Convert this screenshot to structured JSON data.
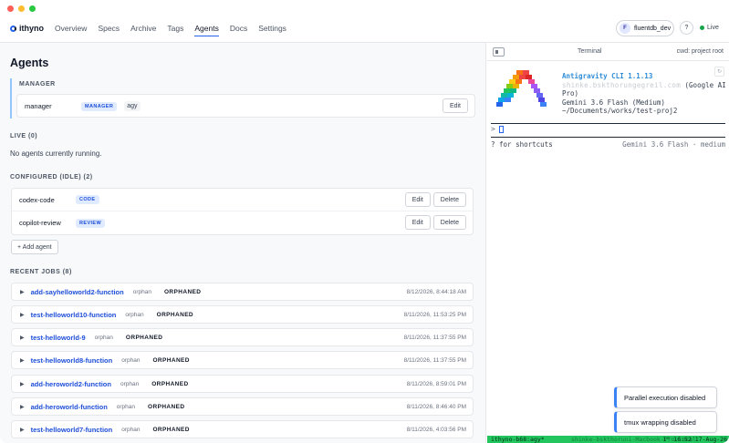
{
  "app": {
    "name": "ithyno"
  },
  "nav": {
    "links": [
      {
        "label": "Overview"
      },
      {
        "label": "Specs"
      },
      {
        "label": "Archive"
      },
      {
        "label": "Tags"
      },
      {
        "label": "Agents"
      },
      {
        "label": "Docs"
      },
      {
        "label": "Settings"
      }
    ],
    "active": "Agents",
    "user": {
      "initial": "F",
      "name": "fluentdb_dev"
    },
    "help": "?",
    "live": "Live",
    "live_color": "#16a34a"
  },
  "page": {
    "title": "Agents",
    "manager": {
      "section": "MANAGER",
      "name": "manager",
      "badge": "MANAGER",
      "model": "agy",
      "edit": "Edit"
    },
    "live": {
      "section": "LIVE (0)",
      "empty": "No agents currently running."
    },
    "configured": {
      "section": "CONFIGURED (IDLE) (2)",
      "agents": [
        {
          "name": "codex-code",
          "badge": "CODE",
          "edit": "Edit",
          "delete": "Delete"
        },
        {
          "name": "copilot-review",
          "badge": "REVIEW",
          "edit": "Edit",
          "delete": "Delete"
        }
      ],
      "add": "+ Add agent"
    },
    "jobs": {
      "section": "RECENT JOBS (8)",
      "items": [
        {
          "name": "add-sayhelloworld2-function",
          "tag": "orphan",
          "status": "ORPHANED",
          "time": "8/12/2026, 8:44:18 AM"
        },
        {
          "name": "test-helloworld10-function",
          "tag": "orphan",
          "status": "ORPHANED",
          "time": "8/11/2026, 11:53:25 PM"
        },
        {
          "name": "test-helloworld-9",
          "tag": "orphan",
          "status": "ORPHANED",
          "time": "8/11/2026, 11:37:55 PM"
        },
        {
          "name": "test-helloworld8-function",
          "tag": "orphan",
          "status": "ORPHANED",
          "time": "8/11/2026, 11:37:55 PM"
        },
        {
          "name": "add-heroworld2-function",
          "tag": "orphan",
          "status": "ORPHANED",
          "time": "8/11/2026, 8:59:01 PM"
        },
        {
          "name": "add-heroworld-function",
          "tag": "orphan",
          "status": "ORPHANED",
          "time": "8/11/2026, 8:46:40 PM"
        },
        {
          "name": "test-helloworld7-function",
          "tag": "orphan",
          "status": "ORPHANED",
          "time": "8/11/2026, 4:03:56 PM"
        }
      ]
    }
  },
  "terminal": {
    "title": "Terminal",
    "cwd": "cwd: project root",
    "refresh": "↻",
    "cli_title": "Antigravity CLI 1.1.13",
    "account_email": "shinke.bskthorungegreil.com",
    "account_plan": "(Google AI Pro)",
    "model_line": "Gemini 3.6 Flash (Medium)",
    "path": "~/Documents/works/test-proj2",
    "prompt": ">",
    "shortcuts": "? for shortcuts",
    "model_status": "Gemini 3.6 Flash · medium"
  },
  "toasts": [
    {
      "text": "Parallel execution disabled"
    },
    {
      "text": "tmux wrapping disabled"
    }
  ],
  "tmux": {
    "left": "ithyno-b68:agy*",
    "middle": "shinke-bskthoruni-Macbook-Pro.local",
    "right": "1\" 16:52 17-Aug-26"
  }
}
